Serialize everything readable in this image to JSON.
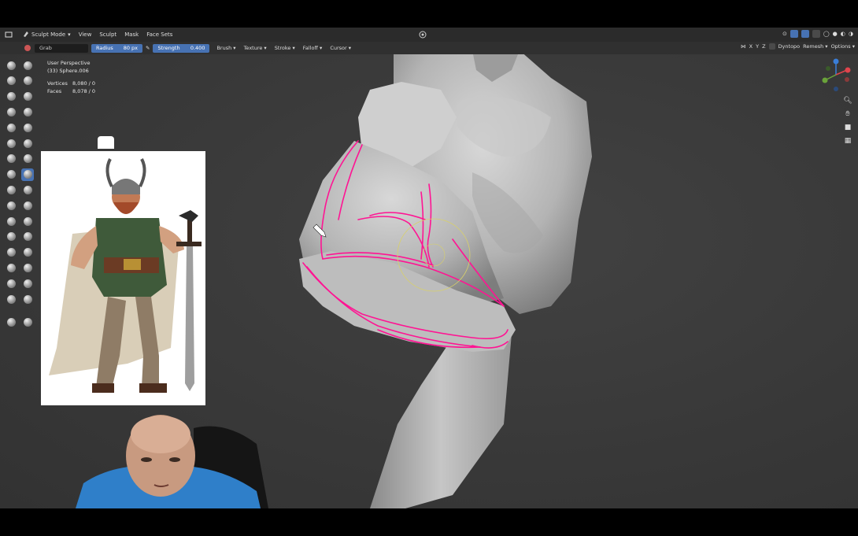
{
  "header": {
    "mode": "Sculpt Mode",
    "menus": [
      "View",
      "Sculpt",
      "Mask",
      "Face Sets"
    ]
  },
  "tool_options": {
    "brush_name": "Grab",
    "radius_label": "Radius",
    "radius_value": "80 px",
    "strength_label": "Strength",
    "strength_value": "0.400",
    "dropdowns": [
      "Brush",
      "Texture",
      "Stroke",
      "Falloff",
      "Cursor"
    ],
    "symmetry": [
      "X",
      "Y",
      "Z"
    ],
    "dyntopo": "Dyntopo",
    "remesh": "Remesh",
    "options": "Options"
  },
  "viewport_info": {
    "view": "User Perspective",
    "object": "(33) Sphere.006",
    "vertices_label": "Vertices",
    "vertices_value": "8,080 / 0",
    "faces_label": "Faces",
    "faces_value": "8,078 / 0"
  },
  "colors": {
    "accent": "#4772b3",
    "annotation": "#ff1493",
    "header": "#2b2b2b",
    "viewport": "#3a3a3a"
  },
  "icons": {
    "nav_gizmo": "axis-gizmo-icon",
    "zoom": "zoom-icon",
    "pan": "hand-icon",
    "camera": "camera-icon",
    "grid": "grid-icon"
  }
}
